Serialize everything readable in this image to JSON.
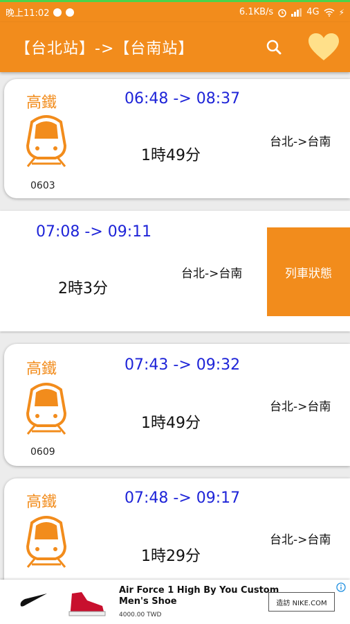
{
  "status_bar": {
    "time": "晚上11:02",
    "network_speed": "6.1KB/s",
    "network_type": "4G"
  },
  "appbar": {
    "title": "【台北站】->【台南站】",
    "icons": [
      "search-icon",
      "heart-icon"
    ]
  },
  "trains": [
    {
      "brand": "高鐵",
      "number": "0603",
      "time_range": "06:48 -> 08:37",
      "duration": "1時49分",
      "route": "台北->台南"
    },
    {
      "time_range": "07:08 -> 09:11",
      "duration": "2時3分",
      "route": "台北->台南",
      "action_label": "列車狀態"
    },
    {
      "brand": "高鐵",
      "number": "0609",
      "time_range": "07:43 -> 09:32",
      "duration": "1時49分",
      "route": "台北->台南"
    },
    {
      "brand": "高鐵",
      "time_range": "07:48 -> 09:17",
      "duration": "1時29分",
      "route": "台北->台南"
    }
  ],
  "ad": {
    "title_line1": "Air Force 1 High By You Custom",
    "title_line2": "Men's Shoe",
    "price": "4000.00 TWD",
    "button_label": "造訪 NIKE.COM"
  },
  "colors": {
    "accent": "#f28c1c",
    "time_blue": "#1e24d8"
  }
}
